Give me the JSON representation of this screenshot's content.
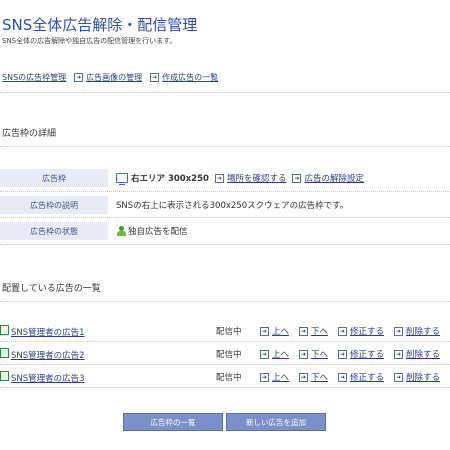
{
  "header": {
    "title": "SNS全体広告解除・配信管理",
    "subtitle": "SNS全体の広告解除や独自広告の配信管理を行います。"
  },
  "topnav": {
    "items": [
      "SNSの広告枠管理",
      "広告画像の管理",
      "作成広告の一覧"
    ]
  },
  "detail": {
    "section_title": "広告枠の詳細",
    "rows": [
      {
        "label": "広告枠",
        "value": "右エリア 300x250",
        "links": [
          "場所を確認する",
          "広告の解除設定"
        ]
      },
      {
        "label": "広告枠の説明",
        "value": "SNSの右上に表示される300x250スクウェアの広告枠です。"
      },
      {
        "label": "広告枠の状態",
        "value": "独自広告を配信"
      }
    ]
  },
  "ads": {
    "section_title": "配置している広告の一覧",
    "items": [
      {
        "name": "SNS管理者の広告1",
        "status": "配信中"
      },
      {
        "name": "SNS管理者の広告2",
        "status": "配信中"
      },
      {
        "name": "SNS管理者の広告3",
        "status": "配信中"
      }
    ],
    "actions": [
      "上へ",
      "下へ",
      "修正する",
      "削除する"
    ]
  },
  "buttons": {
    "list": "広告枠の一覧",
    "add": "新しい広告を追加"
  },
  "icons": [
    "arrow-link-icon",
    "monitor-icon",
    "person-icon",
    "document-icon"
  ],
  "colors": {
    "title": "#2c4fb0",
    "link": "#2a3f8f",
    "label_bg": "#e8ebf6",
    "button_bg": "#7b90c8"
  }
}
